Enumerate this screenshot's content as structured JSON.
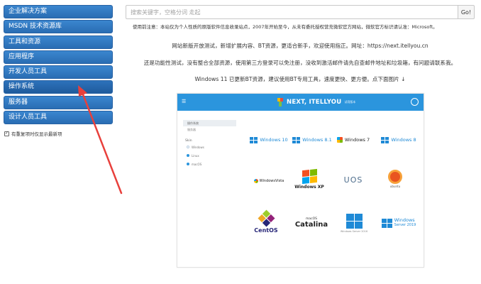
{
  "sidebar": {
    "items": [
      {
        "label": "企业解决方案"
      },
      {
        "label": "MSDN 技术资源库"
      },
      {
        "label": "工具和资源"
      },
      {
        "label": "应用程序"
      },
      {
        "label": "开发人员工具"
      },
      {
        "label": "操作系统"
      },
      {
        "label": "服务器"
      },
      {
        "label": "设计人员工具"
      }
    ],
    "checkbox_label": "有重复项时仅显示最新项",
    "checkbox_mark": "✓"
  },
  "search": {
    "placeholder": "搜索关键字，空格分词 走起",
    "button_label": "Go!"
  },
  "main": {
    "notice": "使用前注意：本站仅为个人性质的原版软件信息收录站点，2007年开始至今，从未有委托授权营充微软官方网站，微软官方标识请认准：Microsoft。",
    "line1": "网站新版开放测试，新增扩展内容、BT资源，更适合新手，欢迎使用指正。网址：https://next.itellyou.cn",
    "line2": "还是功能性测试，没有整合全部资源，使用第三方登录可以免注册，没收到激活邮件请先自查邮件地址和垃圾箱，有问题请联系我。",
    "line3": "Windows 11 已更新BT资源，建议使用BT专用工具，速度更快、更方便。点下面图片 ↓"
  },
  "preview": {
    "header": {
      "menu_glyph": "☰",
      "brand": "NEXT, ITELLYOU",
      "sub": "试用版本"
    },
    "side": {
      "top": "操作系统",
      "item": "服务器",
      "label": "Skin",
      "options": [
        "Windows",
        "Linux",
        "macOS"
      ]
    },
    "tiles": {
      "win10": "Windows 10",
      "win81": "Windows 8.1",
      "win7": "Windows 7",
      "win8": "Windows 8",
      "vista": "WindowsVista",
      "xp": "Windows XP",
      "uos": "UOS",
      "ubuntu": "ubuntu",
      "centos": "CentOS",
      "macos_small": "macOS",
      "catalina": "Catalina",
      "server2016": "Windows Server 2016",
      "server_line1": "Windows",
      "server_line2": "Server 2019"
    }
  },
  "annotation": {
    "arrow_color": "#e8403c"
  }
}
